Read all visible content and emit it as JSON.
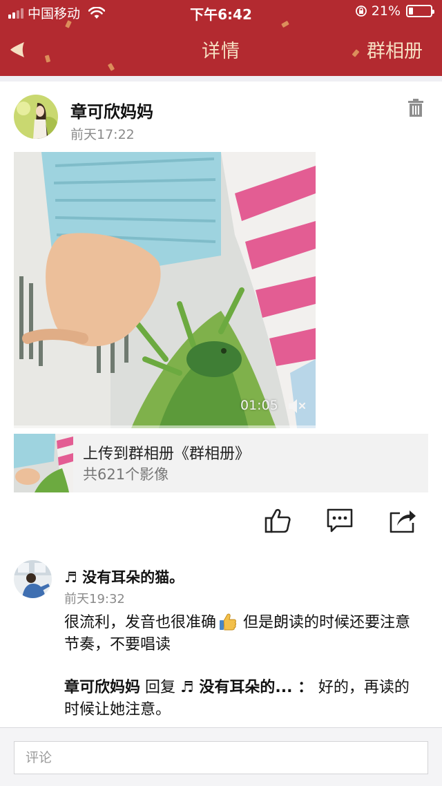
{
  "status_bar": {
    "carrier": "中国移动",
    "time": "下午6:42",
    "battery": "21%",
    "battery_level": 0.21
  },
  "nav": {
    "title": "详情",
    "album_link": "群相册"
  },
  "post": {
    "author": "章可欣妈妈",
    "time": "前天17:22",
    "video": {
      "duration": "01:05",
      "progress": 0.0
    },
    "album": {
      "title": "上传到群相册《群相册》",
      "count": "共621个影像"
    }
  },
  "actions": {
    "icons": [
      "thumbs-up-icon",
      "comment-icon",
      "share-icon"
    ]
  },
  "comment": {
    "author": "♬ 没有耳朵的猫。",
    "time": "前天19:32",
    "text_before_emoji": "很流利，发音也很准确",
    "emoji": "thumbs-up-emoji",
    "text_after_emoji": " 但是朗读的时候还要注意节奏，不要唱读",
    "reply": {
      "from": "章可欣妈妈",
      "verb": " 回复 ",
      "to": "♬ 没有耳朵的...",
      "sep": " ： ",
      "text": "好的，再读的时候让她注意。"
    }
  },
  "comment_box": {
    "placeholder": "评论"
  },
  "colors": {
    "header_red": "#b32a30",
    "header_text": "#f6dfc2",
    "progress_blue": "#3aa0e8"
  }
}
